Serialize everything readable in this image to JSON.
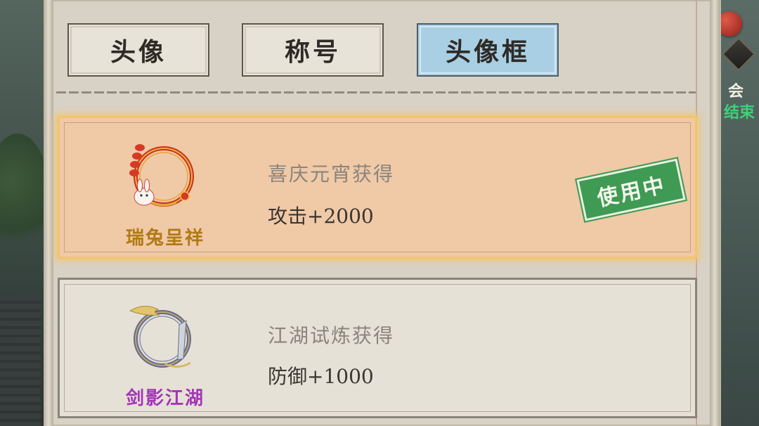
{
  "tabs": [
    {
      "label": "头像",
      "active": false
    },
    {
      "label": "称号",
      "active": false
    },
    {
      "label": "头像框",
      "active": true
    }
  ],
  "side": {
    "text_top": "会",
    "text_bottom": "结束"
  },
  "frames": [
    {
      "name": "瑞兔呈祥",
      "source": "喜庆元宵获得",
      "attribute": "攻击+2000",
      "status": "使用中",
      "icon": "rabbit-lantern-frame-icon"
    },
    {
      "name": "剑影江湖",
      "source": "江湖试炼获得",
      "attribute": "防御+1000",
      "icon": "sword-shadow-frame-icon"
    }
  ],
  "colors": {
    "active_tab": "#a9cfe4",
    "active_card": "#f0c9a7",
    "stamp_green": "#3f9a53",
    "name_gold": "#b07a14",
    "name_purple": "#a335b8"
  }
}
